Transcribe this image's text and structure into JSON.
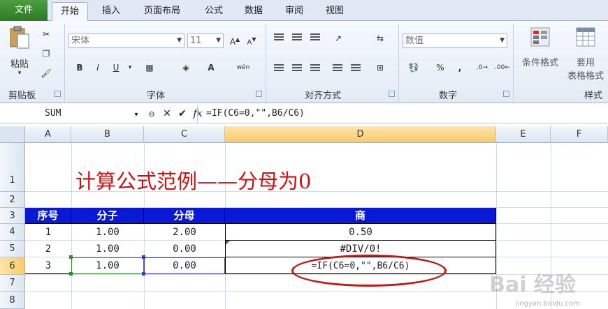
{
  "tabs": [
    "文件",
    "开始",
    "插入",
    "页面布局",
    "公式",
    "数据",
    "审阅",
    "视图"
  ],
  "ribbon": {
    "groups": {
      "clipboard": "剪贴板",
      "font": "字体",
      "align": "对齐方式",
      "number": "数字",
      "styles": "样式"
    },
    "paste_label": "粘贴",
    "font_name": "宋体",
    "font_size": "11",
    "number_format": "数值",
    "cond_format": "条件格式",
    "table_format_line1": "套用",
    "table_format_line2": "表格格式",
    "bold": "B",
    "italic": "I",
    "underline": "U",
    "wen": "wén",
    "percent": "%",
    "comma": ","
  },
  "formula_bar": {
    "name_box": "SUM",
    "formula": "=IF(C6=0,\"\",B6/C6)"
  },
  "columns": [
    "A",
    "B",
    "C",
    "D",
    "E",
    "F"
  ],
  "rows": [
    "1",
    "2",
    "3",
    "4",
    "5",
    "6",
    "7",
    "8"
  ],
  "sheet": {
    "title": "计算公式范例——分母为0",
    "headers": [
      "序号",
      "分子",
      "分母",
      "商"
    ],
    "data": [
      [
        "1",
        "1.00",
        "2.00",
        "0.50"
      ],
      [
        "2",
        "1.00",
        "0.00",
        "#DIV/0!"
      ],
      [
        "3",
        "1.00",
        "0.00",
        "=IF(C6=0,\"\",B6/C6)"
      ]
    ]
  },
  "watermark": "Bai 经验",
  "watermark_url": "jingyan.baidu.com",
  "colors": {
    "header_fill": "#0a19d6",
    "title_red": "#cf1111",
    "oval_red": "#c21818",
    "file_tab_green": "#3a8c2e"
  }
}
